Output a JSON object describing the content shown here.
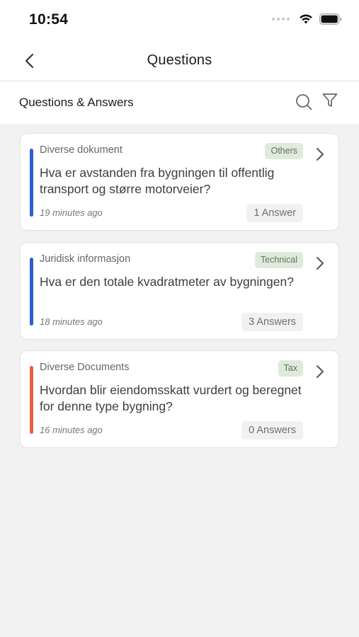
{
  "status_bar": {
    "time": "10:54"
  },
  "nav": {
    "title": "Questions"
  },
  "section": {
    "title": "Questions & Answers"
  },
  "colors": {
    "accent_blue": "#2d5fd3",
    "accent_red": "#e8613f",
    "tag_bg": "#dfe9dc",
    "tag_text": "#5b7a58"
  },
  "cards": [
    {
      "category": "Diverse dokument",
      "tag": "Others",
      "question": "Hva er avstanden fra bygningen til offentlig transport og større motorveier?",
      "time": "19 minutes ago",
      "answers": "1 Answer",
      "accent_color": "#2d5fd3"
    },
    {
      "category": "Juridisk informasjon",
      "tag": "Technical",
      "question": "Hva er den totale kvadratmeter av bygningen?",
      "time": "18 minutes ago",
      "answers": "3 Answers",
      "accent_color": "#2d5fd3"
    },
    {
      "category": "Diverse Documents",
      "tag": "Tax",
      "question": "Hvordan blir eiendomsskatt vurdert og beregnet for denne type bygning?",
      "time": "16 minutes ago",
      "answers": "0 Answers",
      "accent_color": "#e8613f"
    }
  ]
}
